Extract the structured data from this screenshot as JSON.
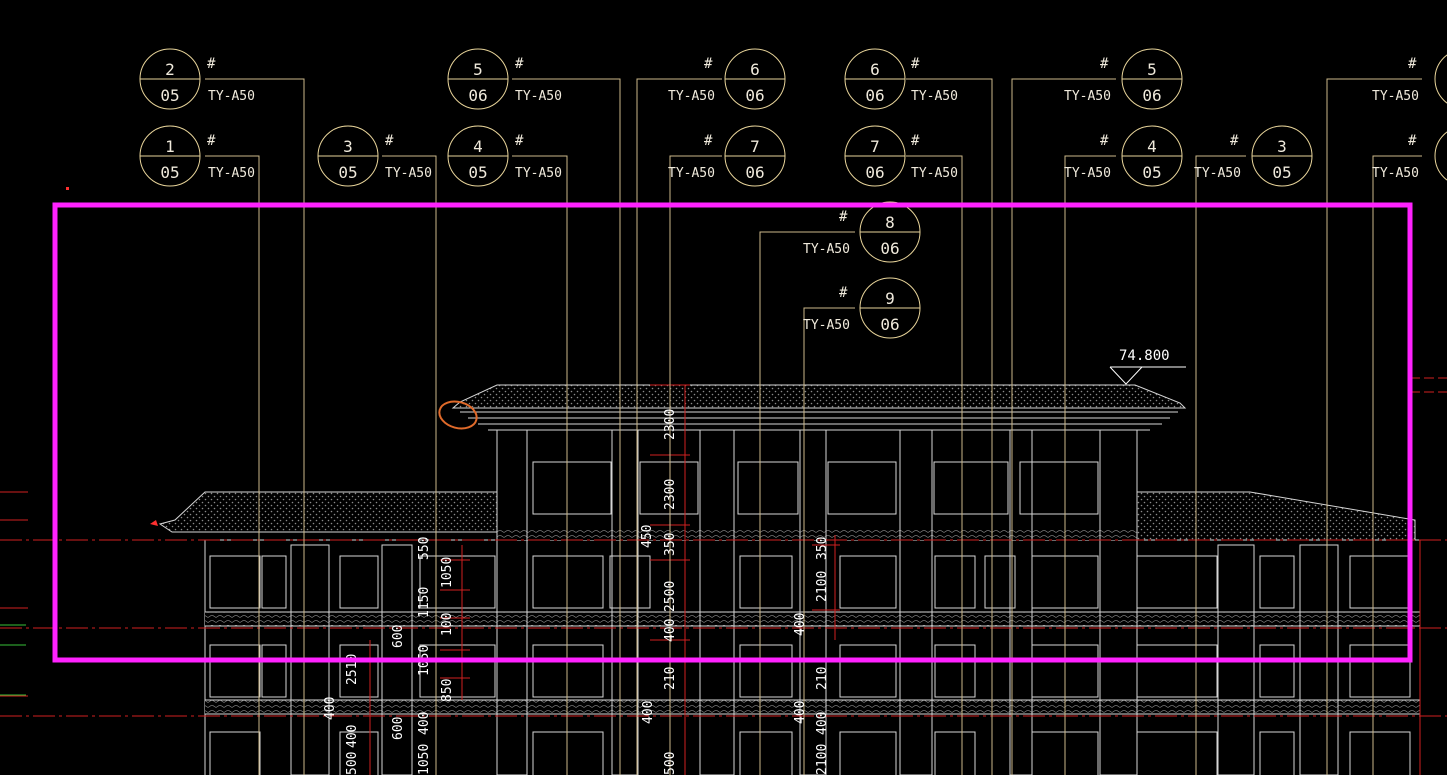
{
  "colors": {
    "background": "#000000",
    "leader": "#cdb98a",
    "bubble": "#e8d49a",
    "text": "#f0eadc",
    "selection": "#ff22ff",
    "markup": "#e06a2a",
    "axis_red": "#d02020",
    "structure": "#d8d8d8",
    "hatch": "#9a9a9a"
  },
  "elevation_mark": "74.800",
  "callouts": [
    {
      "detail": "2",
      "sheet": "05",
      "ref": "TY-A50",
      "mark": "#"
    },
    {
      "detail": "1",
      "sheet": "05",
      "ref": "TY-A50",
      "mark": "#"
    },
    {
      "detail": "3",
      "sheet": "05",
      "ref": "TY-A50",
      "mark": "#"
    },
    {
      "detail": "5",
      "sheet": "06",
      "ref": "TY-A50",
      "mark": "#"
    },
    {
      "detail": "4",
      "sheet": "05",
      "ref": "TY-A50",
      "mark": "#"
    },
    {
      "detail": "6",
      "sheet": "06",
      "ref": "TY-A50",
      "mark": "#"
    },
    {
      "detail": "7",
      "sheet": "06",
      "ref": "TY-A50",
      "mark": "#"
    },
    {
      "detail": "8",
      "sheet": "06",
      "ref": "TY-A50",
      "mark": "#"
    },
    {
      "detail": "9",
      "sheet": "06",
      "ref": "TY-A50",
      "mark": "#"
    },
    {
      "detail": "6",
      "sheet": "06",
      "ref": "TY-A50",
      "mark": "#"
    },
    {
      "detail": "7",
      "sheet": "06",
      "ref": "TY-A50",
      "mark": "#"
    },
    {
      "detail": "5",
      "sheet": "06",
      "ref": "TY-A50",
      "mark": "#"
    },
    {
      "detail": "4",
      "sheet": "05",
      "ref": "TY-A50",
      "mark": "#"
    },
    {
      "detail": "3",
      "sheet": "05",
      "ref": "TY-A50",
      "mark": "#"
    },
    {
      "detail": "",
      "sheet": "",
      "ref": "TY-A50",
      "mark": "#"
    },
    {
      "detail": "",
      "sheet": "",
      "ref": "TY-A50",
      "mark": "#"
    }
  ],
  "dimensions": {
    "d1": "2300",
    "d2": "2300",
    "d3": "450",
    "d4": "350",
    "d5": "350",
    "d6": "550",
    "d7": "1050",
    "d8": "1150",
    "d9": "100",
    "d10": "2500",
    "d11": "2100",
    "d12": "400",
    "d13": "400",
    "d14": "600",
    "d15": "2510",
    "d16": "1050",
    "d17": "850",
    "d18": "400",
    "d19": "400",
    "d20": "600",
    "d21": "400",
    "d22": "400",
    "d23": "400",
    "d24": "210",
    "d25": "210",
    "d26": "500",
    "d27": "1050",
    "d28": "500",
    "d29": "2100",
    "d30": "400"
  }
}
